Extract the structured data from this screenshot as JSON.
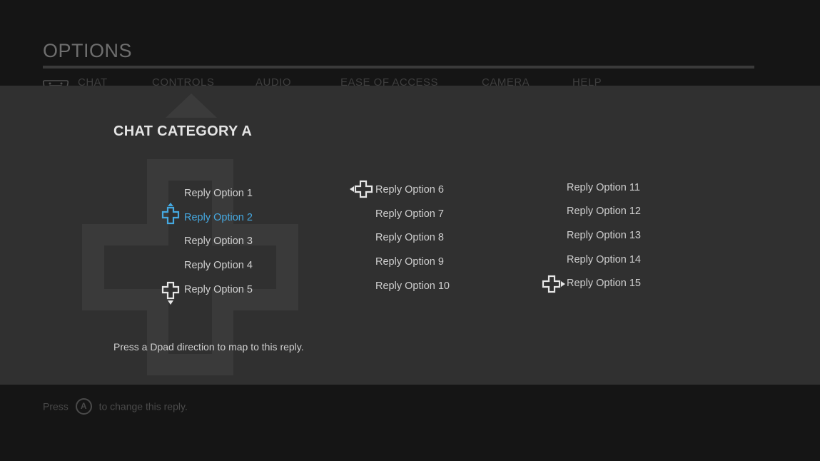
{
  "header": {
    "title": "OPTIONS",
    "tabs": [
      {
        "label": "CHAT",
        "icon": "controller-icon"
      },
      {
        "label": "CONTROLS"
      },
      {
        "label": "AUDIO"
      },
      {
        "label": "EASE OF ACCESS"
      },
      {
        "label": "CAMERA"
      },
      {
        "label": "HELP"
      }
    ]
  },
  "panel": {
    "category_title": "CHAT CATEGORY A",
    "options": [
      {
        "label": "Reply Option 1"
      },
      {
        "label": "Reply Option 2",
        "selected": true,
        "dpad": "up"
      },
      {
        "label": "Reply Option 3"
      },
      {
        "label": "Reply Option 4"
      },
      {
        "label": "Reply Option 5",
        "dpad": "down"
      },
      {
        "label": "Reply Option 6",
        "dpad": "left"
      },
      {
        "label": "Reply Option 7"
      },
      {
        "label": "Reply Option 8"
      },
      {
        "label": "Reply Option 9"
      },
      {
        "label": "Reply Option 10"
      },
      {
        "label": "Reply Option 11"
      },
      {
        "label": "Reply Option 12"
      },
      {
        "label": "Reply Option 13"
      },
      {
        "label": "Reply Option 14"
      },
      {
        "label": "Reply Option 15",
        "dpad": "right"
      }
    ],
    "hint": "Press a Dpad direction to map to this reply."
  },
  "footer": {
    "press": "Press",
    "button": "A",
    "action": "to change this reply."
  },
  "colors": {
    "accent": "#45a8e0",
    "panel": "#303030",
    "background": "#151515"
  }
}
